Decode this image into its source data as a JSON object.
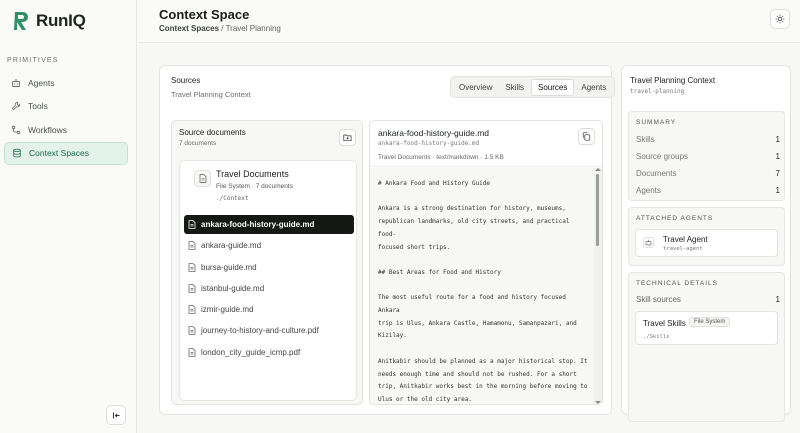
{
  "app": {
    "name": "RunIQ"
  },
  "sidebar": {
    "section_label": "PRIMITIVES",
    "items": [
      {
        "label": "Agents",
        "icon": "bot-icon"
      },
      {
        "label": "Tools",
        "icon": "wrench-icon"
      },
      {
        "label": "Workflows",
        "icon": "workflow-icon"
      },
      {
        "label": "Context Spaces",
        "icon": "database-icon",
        "active": true
      }
    ]
  },
  "header": {
    "title": "Context Space",
    "breadcrumb": {
      "parent": "Context Spaces",
      "separator": "/",
      "current": "Travel Planning"
    }
  },
  "main": {
    "title": "Sources",
    "subtitle": "Travel Planning Context",
    "tabs": [
      {
        "label": "Overview"
      },
      {
        "label": "Skills"
      },
      {
        "label": "Sources",
        "active": true
      },
      {
        "label": "Agents"
      }
    ],
    "docs": {
      "title": "Source documents",
      "count": "7 documents",
      "group": {
        "name": "Travel Documents",
        "meta": "File System · 7 documents",
        "path": "./Context"
      },
      "files": [
        {
          "name": "ankara-food-history-guide.md",
          "active": true
        },
        {
          "name": "ankara-guide.md"
        },
        {
          "name": "bursa-guide.md"
        },
        {
          "name": "istanbul-guide.md"
        },
        {
          "name": "izmir-guide.md"
        },
        {
          "name": "journey-to-history-and-culture.pdf"
        },
        {
          "name": "london_city_guide_icmp.pdf"
        }
      ]
    },
    "preview": {
      "name": "ankara-food-history-guide.md",
      "file": "ankara-food-history-guide.md",
      "meta": "Travel Documents · text/markdown · 1.5 KB",
      "content": "# Ankara Food and History Guide\n\nAnkara is a strong destination for history, museums,\nrepublican landmarks, old city streets, and practical food-\nfocused short trips.\n\n## Best Areas for Food and History\n\nThe most useful route for a food and history focused Ankara\ntrip is Ulus, Ankara Castle, Hamamonu, Samanpazari, and\nKizilay.\n\nAnitkabir should be planned as a major historical stop. It\nneeds enough time and should not be rushed. For a short\ntrip, Anitkabir works best in the morning before moving to\nUlus or the old city area.\n\nAnkara Castle is useful for panoramic views, old streets,"
    }
  },
  "right": {
    "title": "Travel Planning Context",
    "id": "travel-planning",
    "summary": {
      "label": "SUMMARY",
      "rows": [
        {
          "label": "Skills",
          "value": "1"
        },
        {
          "label": "Source groups",
          "value": "1"
        },
        {
          "label": "Documents",
          "value": "7"
        },
        {
          "label": "Agents",
          "value": "1"
        }
      ]
    },
    "attached": {
      "label": "ATTACHED AGENTS",
      "agent_name": "Travel Agent",
      "agent_id": "travel-agent"
    },
    "technical": {
      "label": "TECHNICAL DETAILS",
      "skill_sources_label": "Skill sources",
      "skill_sources_value": "1",
      "skill_name": "Travel Skills",
      "skill_badge": "File System",
      "skill_path": "./Skills"
    }
  }
}
